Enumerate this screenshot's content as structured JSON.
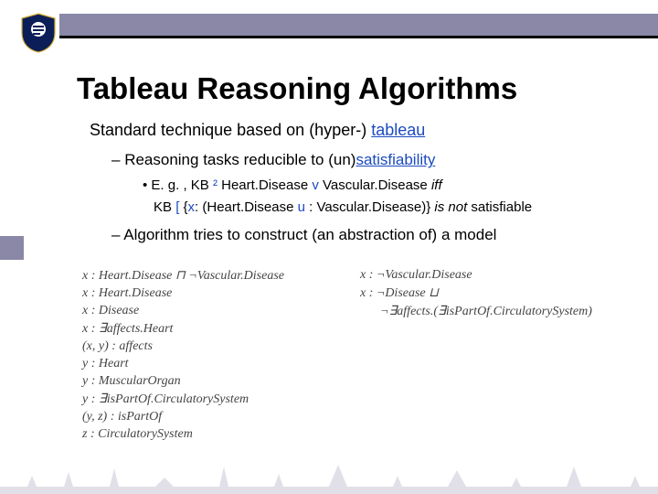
{
  "title": "Tableau Reasoning Algorithms",
  "line1": {
    "pre": "Standard technique based on (hyper-) ",
    "kw": "tableau"
  },
  "bullet1": {
    "pre": "Reasoning tasks reducible to (un)",
    "kw": "satisfiability"
  },
  "ex1": {
    "a": "E. g. , KB ",
    "sym1": "²",
    "c1": " Heart.Disease ",
    "v": "v",
    "c2": " Vascular.Disease ",
    "iff": "iff"
  },
  "ex2": {
    "a": "KB ",
    "lb": "[",
    "b": " {",
    "x": "x",
    "c": ": (Heart.Disease ",
    "u": "u",
    "d": " : Vascular.Disease)} ",
    "isnot": "is not",
    "e": " satisfiable"
  },
  "bullet2": "Algorithm tries to construct (an abstraction of) a model",
  "left": [
    "x : Heart.Disease ⊓ ¬Vascular.Disease",
    "x : Heart.Disease",
    "x : Disease",
    "x : ∃affects.Heart",
    "(x, y) : affects",
    "y : Heart",
    "y : MuscularOrgan",
    "y : ∃isPartOf.CirculatorySystem",
    "(y, z) : isPartOf",
    "z : CirculatorySystem"
  ],
  "right": [
    "x : ¬Vascular.Disease",
    "x : ¬Disease ⊔",
    "¬∃affects.(∃isPartOf.CirculatorySystem)"
  ]
}
